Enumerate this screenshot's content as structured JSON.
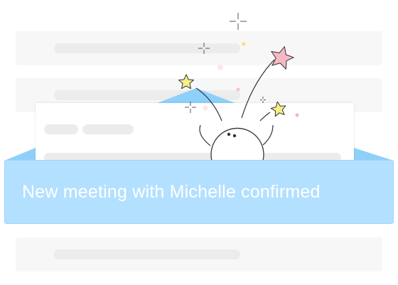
{
  "notification": {
    "message": "New meeting with Michelle confirmed"
  },
  "colors": {
    "banner": "#b3e0ff",
    "envelope_flap": "#8fd0fb",
    "star_yellow": "#f7ef8a",
    "star_pink": "#f7b8c4",
    "placeholder": "#ececec",
    "card_bg": "#f7f7f7"
  },
  "icons": [
    "star-icon",
    "sparkle-icon",
    "confetti-dot"
  ]
}
